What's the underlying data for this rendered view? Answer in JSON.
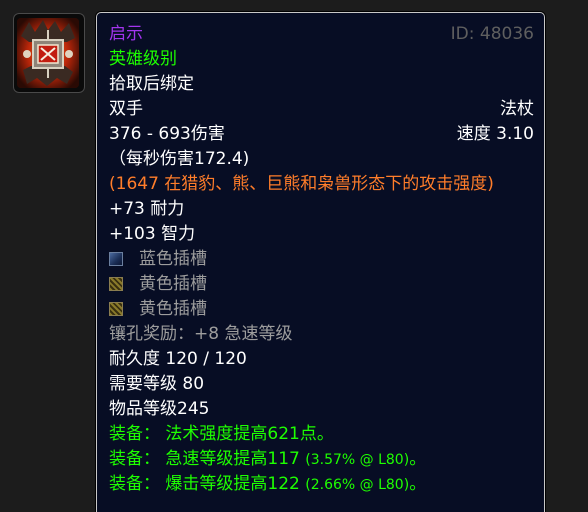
{
  "icon": {
    "name": "item-icon"
  },
  "item": {
    "name": "启示",
    "id": "ID: 48036",
    "quality": "英雄级别",
    "binding": "拾取后绑定",
    "hand": "双手",
    "weapon_type": "法杖",
    "damage": "376 - 693伤害",
    "speed": "速度 3.10",
    "dps": "（每秒伤害172.4)",
    "feral_ap": "(1647 在猎豹、熊、巨熊和枭兽形态下的攻击强度)",
    "stamina": "+73 耐力",
    "intellect": "+103 智力",
    "sockets": [
      {
        "color": "blue",
        "label": "蓝色插槽"
      },
      {
        "color": "yellow",
        "label": "黄色插槽"
      },
      {
        "color": "yellow",
        "label": "黄色插槽"
      }
    ],
    "socket_bonus": "镶孔奖励：+8 急速等级",
    "durability": "耐久度 120 / 120",
    "required_level": "需要等级 80",
    "item_level": "物品等级245",
    "equips": [
      {
        "prefix": "装备：",
        "text": "法术强度提高621点。",
        "note": "",
        "suffix": ""
      },
      {
        "prefix": "装备：",
        "text": "急速等级提高117",
        "note": "(3.57% @ L80)",
        "suffix": "。"
      },
      {
        "prefix": "装备：",
        "text": "爆击等级提高122",
        "note": "(2.66% @ L80)",
        "suffix": "。"
      }
    ]
  },
  "colors": {
    "epic": "#a335ee",
    "uncommon": "#1eff00",
    "artifact_orange": "#ff7d2a",
    "poor_gray": "#9d9d9d",
    "background": "#070d24"
  }
}
